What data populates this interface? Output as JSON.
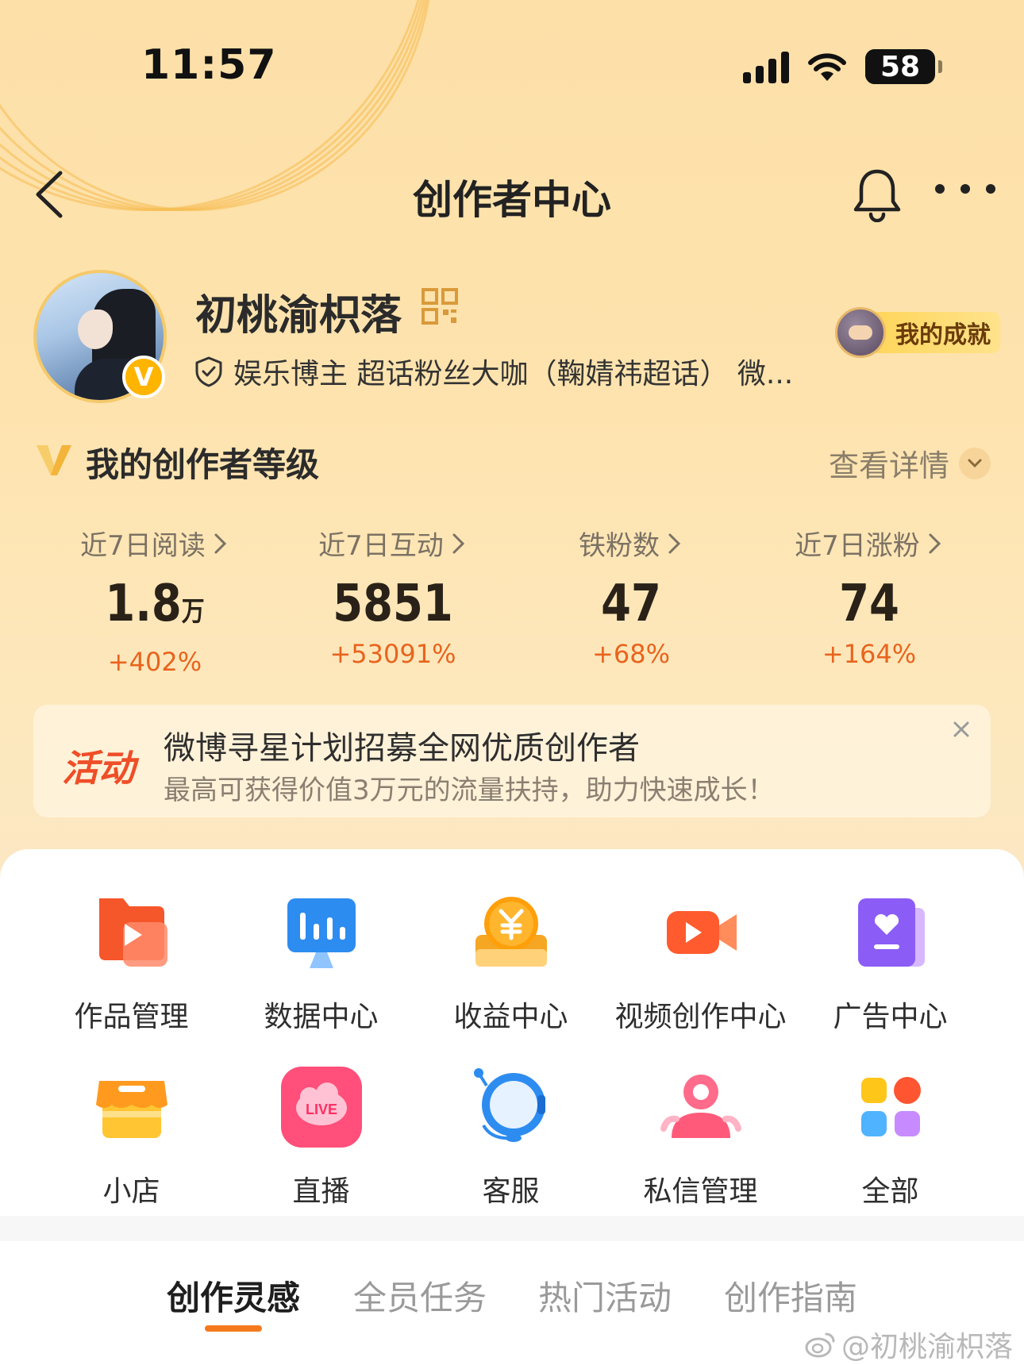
{
  "status_bar": {
    "time": "11:57",
    "battery": "58"
  },
  "nav": {
    "title": "创作者中心"
  },
  "profile": {
    "username": "初桃渝枳落",
    "verified_badge": "V",
    "tags": "娱乐博主 超话粉丝大咖（鞠婧祎超话） 微...",
    "achievement_label": "我的成就"
  },
  "level": {
    "title": "我的创作者等级",
    "detail_label": "查看详情"
  },
  "stats": [
    {
      "label": "近7日阅读",
      "value": "1.8",
      "unit": "万",
      "change": "+402%"
    },
    {
      "label": "近7日互动",
      "value": "5851",
      "unit": "",
      "change": "+53091%"
    },
    {
      "label": "铁粉数",
      "value": "47",
      "unit": "",
      "change": "+68%"
    },
    {
      "label": "近7日涨粉",
      "value": "74",
      "unit": "",
      "change": "+164%"
    }
  ],
  "activity": {
    "tag": "活动",
    "title": "微博寻星计划招募全网优质创作者",
    "subtitle": "最高可获得价值3万元的流量扶持，助力快速成长！"
  },
  "functions": [
    {
      "label": "作品管理",
      "icon": "works-folder-icon"
    },
    {
      "label": "数据中心",
      "icon": "data-chart-icon"
    },
    {
      "label": "收益中心",
      "icon": "yuan-coin-icon"
    },
    {
      "label": "视频创作中心",
      "icon": "video-camera-icon"
    },
    {
      "label": "广告中心",
      "icon": "ad-book-icon"
    },
    {
      "label": "小店",
      "icon": "shop-icon"
    },
    {
      "label": "直播",
      "icon": "live-icon"
    },
    {
      "label": "客服",
      "icon": "headset-icon"
    },
    {
      "label": "私信管理",
      "icon": "message-person-icon"
    },
    {
      "label": "全部",
      "icon": "all-grid-icon"
    }
  ],
  "live_icon_text": "LIVE",
  "tabs": [
    "创作灵感",
    "全员任务",
    "热门活动",
    "创作指南"
  ],
  "watermark": "@初桃渝枳落",
  "colors": {
    "accent": "#f57a1e",
    "increase": "#e8641e",
    "activity_tag": "#ee4e28"
  }
}
